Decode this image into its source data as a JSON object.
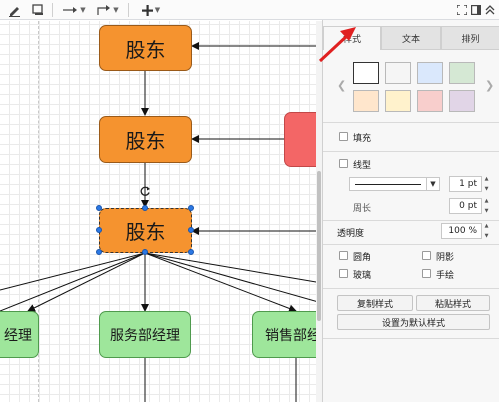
{
  "toolbar": {
    "items": [
      {
        "icon": "pencil-icon"
      },
      {
        "icon": "shadow-square-icon"
      },
      {
        "icon": "connection-arrow-icon"
      },
      {
        "icon": "waypoint-elbow-icon"
      },
      {
        "icon": "plus-insert-icon"
      },
      {
        "icon": "fullscreen-icon"
      },
      {
        "icon": "split-panel-icon"
      },
      {
        "icon": "collapse-up-icon"
      }
    ]
  },
  "canvas": {
    "nodes": {
      "top": "股东",
      "middle": "股东",
      "selected": "股东",
      "left_manager": "经理",
      "service_manager": "服务部经理",
      "sales_manager": "销售部经"
    }
  },
  "panel": {
    "tabs": {
      "style": "样式",
      "text": "文本",
      "arrange": "排列"
    },
    "swatches": [
      "#ffffff",
      "#f5f5f5",
      "#dae8fc",
      "#d5e8d4",
      "#ffe6cc",
      "#fff2cc",
      "#f8cecc",
      "#e1d5e7"
    ],
    "fill_label": "填充",
    "line_label": "线型",
    "line_width": "1 pt",
    "perimeter_label": "周长",
    "perimeter_value": "0 pt",
    "opacity_label": "透明度",
    "opacity_value": "100 %",
    "options": {
      "rounded": "圆角",
      "shadow": "阴影",
      "glass": "玻璃",
      "sketch": "手绘"
    },
    "buttons": {
      "copy_style": "复制样式",
      "paste_style": "粘贴样式",
      "set_default": "设置为默认样式"
    }
  },
  "colors": {
    "node_orange": "#f5932f",
    "node_green": "#9ee69b",
    "node_red": "#f36666",
    "selection_blue": "#2b78e4",
    "annotation_red": "#e02020"
  }
}
